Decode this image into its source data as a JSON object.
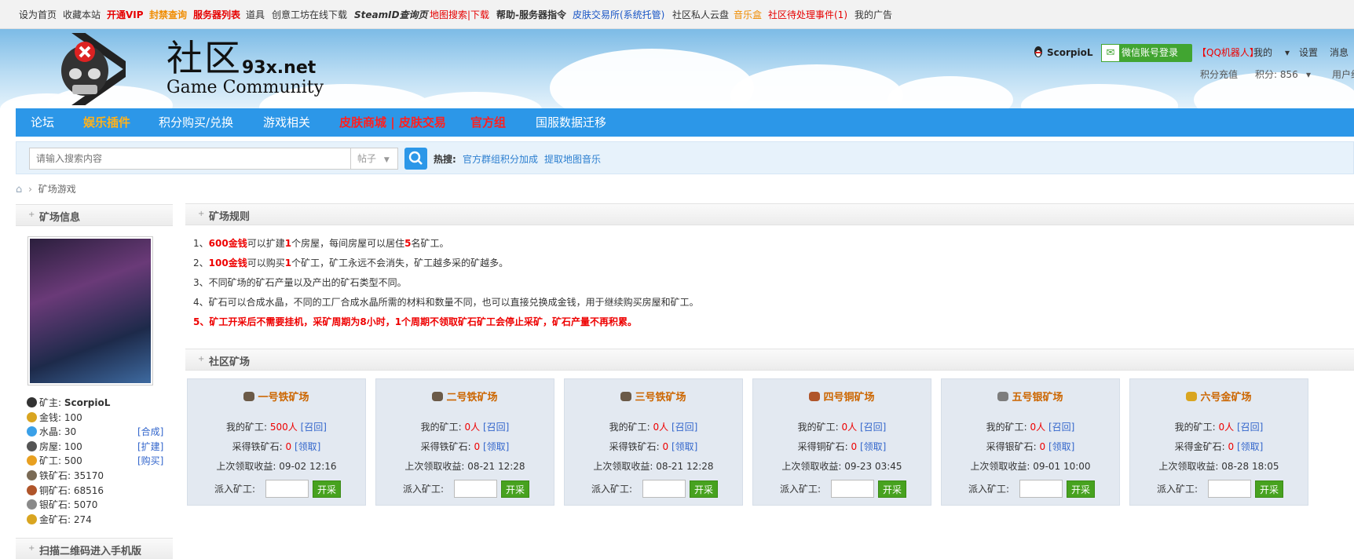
{
  "topbar": {
    "items": [
      {
        "label": "设为首页",
        "color": "#333333"
      },
      {
        "label": "收藏本站",
        "color": "#333333"
      },
      {
        "label": "开通VIP",
        "color": "#e60000"
      },
      {
        "label": "封禁查询",
        "color": "#f08c00"
      },
      {
        "label": "服务器列表",
        "color": "#e60000"
      },
      {
        "label": "道具",
        "color": "#333333"
      },
      {
        "label": "创意工坊在线下载",
        "color": "#333333"
      },
      {
        "label": "SteamID查询页",
        "color": "#333333"
      },
      {
        "label": "地图搜索|下载",
        "color": "#e60000"
      },
      {
        "label": "帮助-服务器指令",
        "color": "#333333"
      },
      {
        "label": "皮肤交易所(系统托管)",
        "color": "#1a56c6"
      },
      {
        "label": "社区私人云盘",
        "color": "#333333"
      },
      {
        "label": "音乐盒",
        "color": "#f08c00"
      },
      {
        "label": "社区待处理事件(1)",
        "color": "#e60000"
      },
      {
        "label": "我的广告",
        "color": "#333333"
      }
    ]
  },
  "header": {
    "logo_cn": "社区",
    "logo_domain": "93x.net",
    "logo_en": "Game Community",
    "username": "ScorpioL",
    "wechat_label": "微信账号登录",
    "qq_robot": "【QQ机器人】",
    "my": "我的",
    "settings": "设置",
    "messages": "消息",
    "points_recharge": "积分充值",
    "points": "积分: 856",
    "user_group": "用户组"
  },
  "nav": {
    "items": [
      {
        "label": "论坛",
        "color": "#ffffff"
      },
      {
        "label": "娱乐插件",
        "color": "#ffb21a"
      },
      {
        "label": "积分购买/兑换",
        "color": "#ffffff"
      },
      {
        "label": "游戏相关",
        "color": "#ffffff"
      },
      {
        "label": "皮肤商城 | 皮肤交易",
        "color": "#ff2020"
      },
      {
        "label": "官方组",
        "color": "#ff2020"
      },
      {
        "label": "国服数据迁移",
        "color": "#ffffff"
      }
    ]
  },
  "search": {
    "placeholder": "请输入搜索内容",
    "type": "帖子",
    "hot_label": "热搜:",
    "hot_items": [
      "官方群组积分加成",
      "提取地图音乐"
    ]
  },
  "breadcrumb": {
    "current": "矿场游戏"
  },
  "sidebar": {
    "title": "矿场信息",
    "stats": [
      {
        "label": "矿主:",
        "value": "ScorpioL",
        "link": "",
        "icon_color": "#333333"
      },
      {
        "label": "金钱:",
        "value": "100",
        "link": "",
        "icon_color": "#d9a520"
      },
      {
        "label": "水晶:",
        "value": "30",
        "link": "[合成]",
        "icon_color": "#3aa0e8"
      },
      {
        "label": "房屋:",
        "value": "100",
        "link": "[扩建]",
        "icon_color": "#555555"
      },
      {
        "label": "矿工:",
        "value": "500",
        "link": "[购买]",
        "icon_color": "#e8a020"
      },
      {
        "label": "铁矿石:",
        "value": "35170",
        "link": "",
        "icon_color": "#7a6a55"
      },
      {
        "label": "铜矿石:",
        "value": "68516",
        "link": "",
        "icon_color": "#b0552a"
      },
      {
        "label": "银矿石:",
        "value": "5070",
        "link": "",
        "icon_color": "#8a8a8a"
      },
      {
        "label": "金矿石:",
        "value": "274",
        "link": "",
        "icon_color": "#d9a520"
      }
    ],
    "qr_title": "扫描二维码进入手机版"
  },
  "rules": {
    "title": "矿场规则",
    "items": [
      [
        "1、",
        "600金钱",
        "可以扩建",
        "1",
        "个房屋，每间房屋可以居住",
        "5",
        "名矿工。"
      ],
      [
        "2、",
        "100金钱",
        "可以购买",
        "1",
        "个矿工，矿工永远不会消失，矿工越多采的矿越多。",
        "",
        ""
      ],
      [
        "3、不同矿场的矿石产量以及产出的矿石类型不同。"
      ],
      [
        "4、矿石可以合成水晶，不同的工厂合成水晶所需的材料和数量不同，也可以直接兑换成金钱，用于继续购买房屋和矿工。"
      ],
      [
        "5、矿工开采后不需要挂机，采矿周期为8小时，1个周期不领取矿石矿工会停止采矿，矿石产量不再积累。"
      ]
    ]
  },
  "mines_section": {
    "title": "社区矿场"
  },
  "mines": [
    {
      "name": "一号铁矿场",
      "workers": "500",
      "ore_label": "采得铁矿石:",
      "ore": "0",
      "last": "09-02 12:16",
      "icon_color": "#6b5a48"
    },
    {
      "name": "二号铁矿场",
      "workers": "0",
      "ore_label": "采得铁矿石:",
      "ore": "0",
      "last": "08-21 12:28",
      "icon_color": "#6b5a48"
    },
    {
      "name": "三号铁矿场",
      "workers": "0",
      "ore_label": "采得铁矿石:",
      "ore": "0",
      "last": "08-21 12:28",
      "icon_color": "#6b5a48"
    },
    {
      "name": "四号铜矿场",
      "workers": "0",
      "ore_label": "采得铜矿石:",
      "ore": "0",
      "last": "09-23 03:45",
      "icon_color": "#b0552a"
    },
    {
      "name": "五号银矿场",
      "workers": "0",
      "ore_label": "采得银矿石:",
      "ore": "0",
      "last": "09-01 10:00",
      "icon_color": "#7d7d7d"
    },
    {
      "name": "六号金矿场",
      "workers": "0",
      "ore_label": "采得金矿石:",
      "ore": "0",
      "last": "08-28 18:05",
      "icon_color": "#d9a520"
    }
  ],
  "mine_labels": {
    "my_workers": "我的矿工:",
    "unit": "人",
    "recall": "[召回]",
    "collect": "[领取]",
    "last_income": "上次领取收益:",
    "dispatch": "派入矿工:",
    "start": "开采"
  }
}
